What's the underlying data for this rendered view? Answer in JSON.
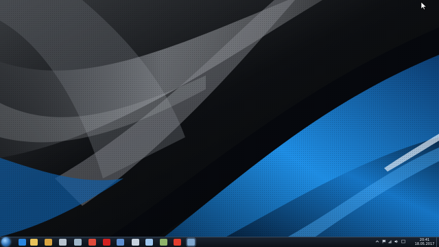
{
  "taskbar": {
    "start_icon": "windows-orb-icon",
    "pinned": [
      {
        "icon": "internet-explorer-icon",
        "color": "#2a86e0"
      },
      {
        "icon": "file-explorer-icon",
        "color": "#e8c25a"
      },
      {
        "icon": "app-icon",
        "color": "#d9a441"
      },
      {
        "icon": "app-icon",
        "color": "#b7c3cf"
      },
      {
        "icon": "app-icon",
        "color": "#9fb6c9"
      },
      {
        "icon": "app-icon",
        "color": "#e04a3a"
      },
      {
        "icon": "record-icon",
        "color": "#d22020"
      },
      {
        "icon": "visual-studio-icon",
        "color": "#5e8fd1"
      },
      {
        "icon": "document-icon",
        "color": "#c7d2de"
      },
      {
        "icon": "document-icon",
        "color": "#9fc7ee"
      },
      {
        "icon": "settings-app-icon",
        "color": "#8fb36a"
      },
      {
        "icon": "opera-browser-icon",
        "color": "#e23d2d"
      },
      {
        "icon": "app-icon",
        "color": "#7fa7cf"
      }
    ],
    "tray_icons": [
      "show-hidden-icons-icon",
      "flag-icon",
      "network-icon",
      "volume-icon",
      "language-icon"
    ],
    "clock": {
      "time": "20:41",
      "date": "18.05.2017"
    }
  },
  "colors": {
    "accent_blue": "#1f8fe6",
    "taskbar": "#0f1720"
  }
}
